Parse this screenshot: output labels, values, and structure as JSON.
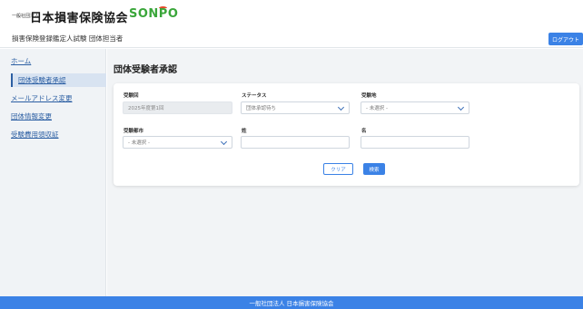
{
  "header": {
    "org_prefix": "一般社団法人",
    "org_name": "日本損害保険協会",
    "brand": "SONPO",
    "brand_color": "#3aa63a",
    "brand_mark_color": "#e24a2a"
  },
  "subheader": {
    "title": "損害保険登録鑑定人試験 団体担当者",
    "logout_label": "ログアウト"
  },
  "sidebar": {
    "items": [
      {
        "label": "ホーム",
        "active": false
      },
      {
        "label": "団体受験者承認",
        "active": true
      },
      {
        "label": "メールアドレス変更",
        "active": false
      },
      {
        "label": "団体情報変更",
        "active": false
      },
      {
        "label": "受験費用領収証",
        "active": false
      }
    ]
  },
  "main": {
    "title": "団体受験者承認",
    "form": {
      "exam_round": {
        "label": "受験回",
        "value": "2025年度第1回"
      },
      "status": {
        "label": "ステータス",
        "value": "団体承認待ち"
      },
      "exam_site": {
        "label": "受験地",
        "value": "- 未選択 -"
      },
      "prefecture": {
        "label": "受験都市",
        "value": "- 未選択 -"
      },
      "last_name": {
        "label": "姓",
        "value": ""
      },
      "first_name": {
        "label": "名",
        "value": ""
      }
    },
    "clear_label": "クリア",
    "search_label": "検索"
  },
  "footer": {
    "text": "一般社団法人 日本損害保険協会"
  },
  "colors": {
    "accent": "#3b82e6",
    "sidebar_bg": "#f0f3f6",
    "main_bg": "#f2f4f6"
  }
}
